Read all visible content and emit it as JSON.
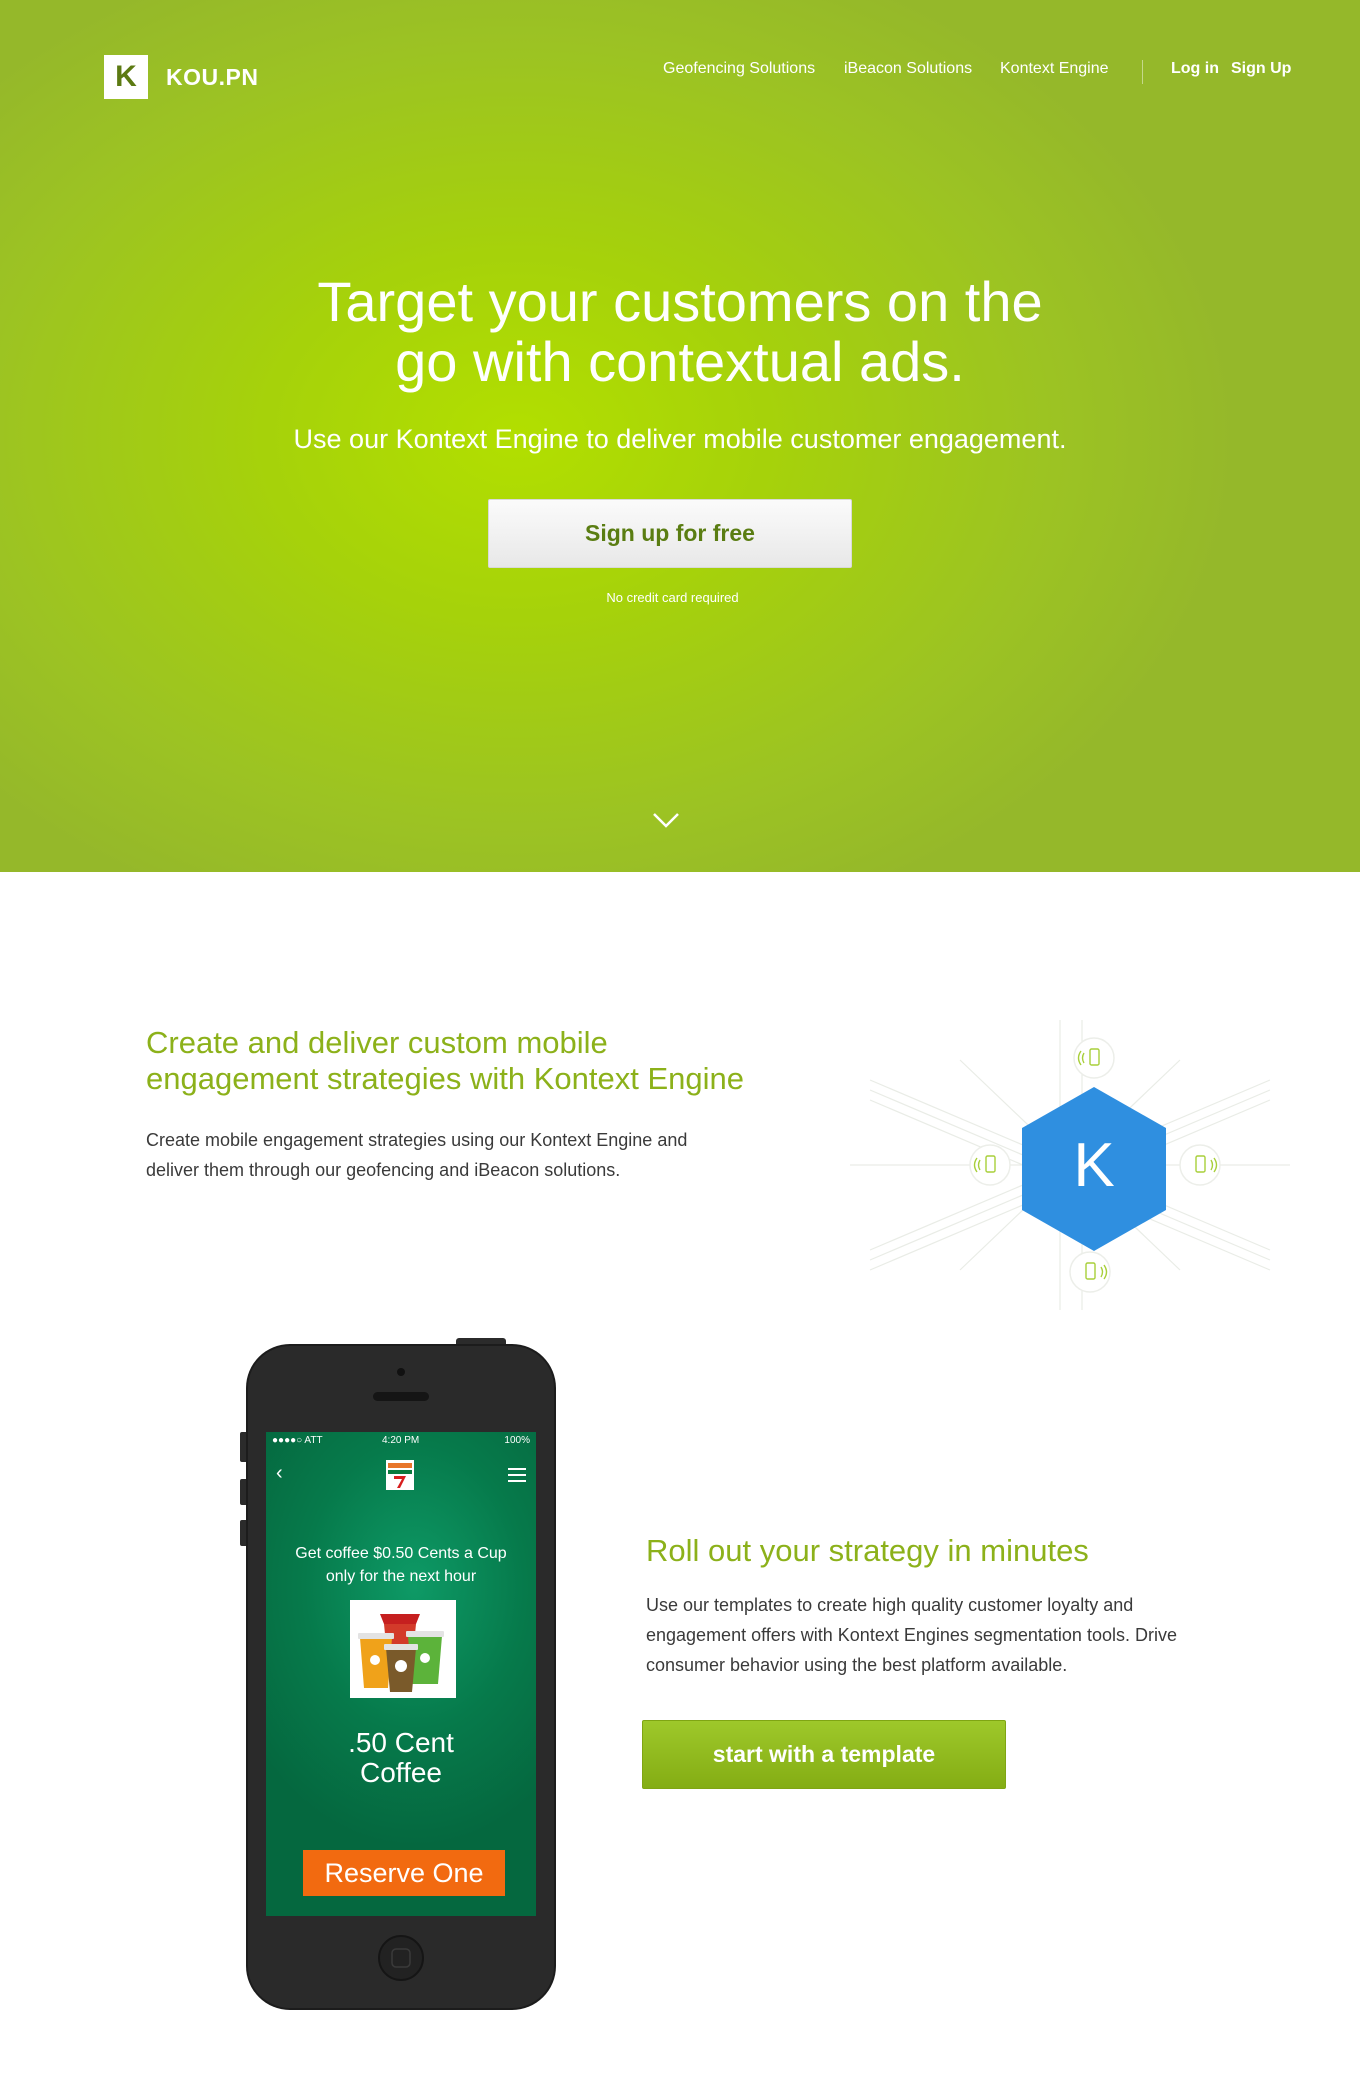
{
  "header": {
    "logo_letter": "K",
    "logo_text": "KOU.PN",
    "nav": [
      "Geofencing Solutions",
      "iBeacon Solutions",
      "Kontext Engine"
    ],
    "login": "Log in",
    "signup": "Sign Up"
  },
  "hero": {
    "title_line1": "Target your customers on the",
    "title_line2": "go with contextual ads.",
    "subtitle": "Use our Kontext Engine to deliver mobile customer engagement.",
    "cta": "Sign up for free",
    "note": "No credit card required"
  },
  "section1": {
    "title_line1": "Create and deliver custom mobile",
    "title_line2": "engagement strategies with Kontext Engine",
    "text": "Create mobile engagement strategies using our Kontext Engine and deliver them through our geofencing and iBeacon solutions.",
    "hex_letter": "K"
  },
  "phone": {
    "carrier": "●●●●○ ATT",
    "time": "4:20 PM",
    "battery": "100%",
    "back": "‹",
    "offer": "Get coffee $0.50 Cents a Cup only for the next hour",
    "title_line1": ".50 Cent",
    "title_line2": "Coffee",
    "button": "Reserve One"
  },
  "section2": {
    "title": "Roll out your strategy in minutes",
    "text": "Use our templates to create high quality customer loyalty and engagement offers with Kontext Engines segmentation tools. Drive consumer behavior using the best platform available.",
    "cta": "start with a template"
  },
  "colors": {
    "brand_green": "#9cc323",
    "heading_green": "#8cb11a",
    "hex_blue": "#2f8fe0",
    "reserve_orange": "#f26a10"
  },
  "icons": [
    "chevron-down-icon",
    "phone-signal-icon",
    "hamburger-menu-icon",
    "back-chevron-icon"
  ]
}
